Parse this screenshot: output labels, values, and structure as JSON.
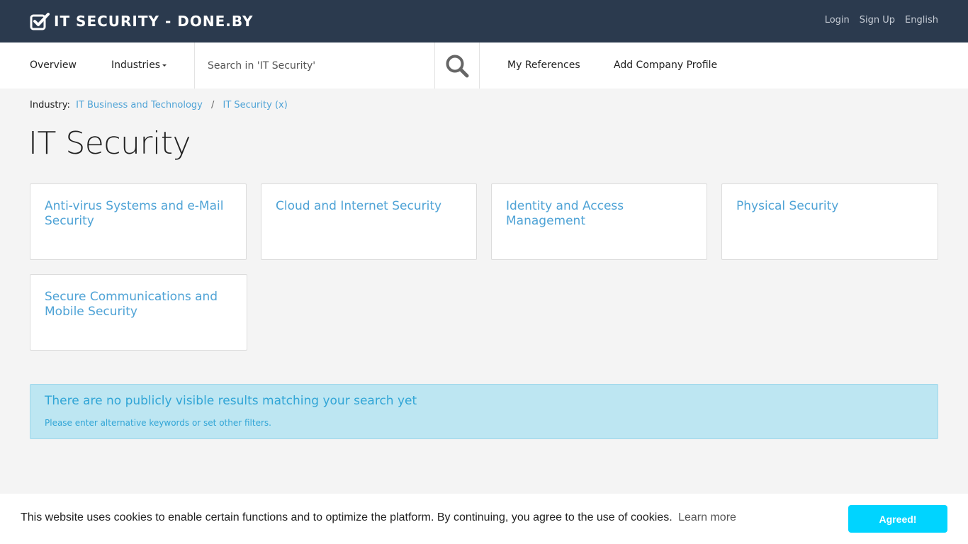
{
  "brand": {
    "title": "IT SECURITY - DONE.BY",
    "icon": "checkbox-check-icon"
  },
  "top_links": {
    "login": "Login",
    "signup": "Sign Up",
    "language": "English"
  },
  "nav": {
    "overview": "Overview",
    "industries": "Industries",
    "search_placeholder": "Search in 'IT Security'",
    "search_icon": "search-icon",
    "my_references": "My References",
    "add_company_profile": "Add Company Profile"
  },
  "breadcrumb": {
    "label": "Industry:",
    "items": [
      "IT Business and Technology",
      "IT Security (x)"
    ],
    "separator": "/"
  },
  "page_title": "IT Security",
  "categories": [
    "Anti-virus Systems and e-Mail Security",
    "Cloud and Internet Security",
    "Identity and Access Management",
    "Physical Security",
    "Secure Communications and Mobile Security"
  ],
  "alert": {
    "title": "There are no publicly visible results matching your search yet",
    "subtitle": "Please enter alternative keywords or set other filters."
  },
  "cookie": {
    "message": "This website uses cookies to enable certain functions and to optimize the platform. By continuing, you agree to the use of cookies.",
    "learn_more": "Learn more",
    "accept": "Agreed!"
  },
  "colors": {
    "topbar": "#2b3a4e",
    "link": "#4fa3d6",
    "alert_bg": "#bde6f2",
    "alert_text": "#31a5d6",
    "accept_button": "#00d4ff"
  }
}
